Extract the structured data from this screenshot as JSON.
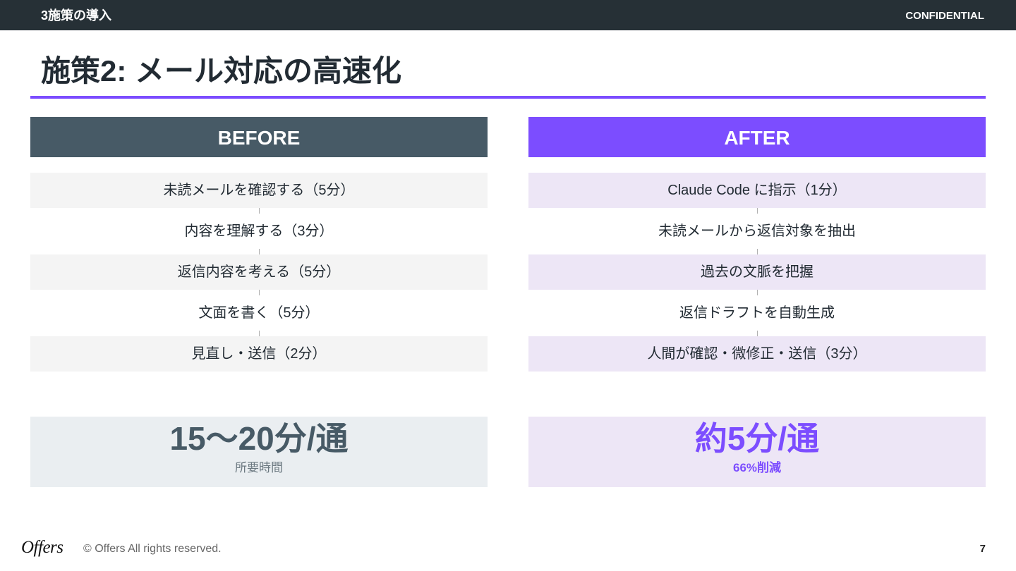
{
  "header": {
    "section": "3施策の導入",
    "confidential": "CONFIDENTIAL"
  },
  "title": "施策2: メール対応の高速化",
  "before": {
    "label": "BEFORE",
    "steps": [
      "未読メールを確認する（5分）",
      "内容を理解する（3分）",
      "返信内容を考える（5分）",
      "文面を書く（5分）",
      "見直し・送信（2分）"
    ],
    "summary_value": "15〜20分/通",
    "summary_caption": "所要時間"
  },
  "after": {
    "label": "AFTER",
    "steps": [
      "Claude Code に指示（1分）",
      "未読メールから返信対象を抽出",
      "過去の文脈を把握",
      "返信ドラフトを自動生成",
      "人間が確認・微修正・送信（3分）"
    ],
    "summary_value": "約5分/通",
    "summary_caption": "66%削減"
  },
  "footer": {
    "logo": "Offers",
    "copyright": "© Offers All rights reserved.",
    "page_number": "7"
  },
  "colors": {
    "accent": "#7c4dff",
    "before_header": "#475a66",
    "topbar": "#263036"
  }
}
